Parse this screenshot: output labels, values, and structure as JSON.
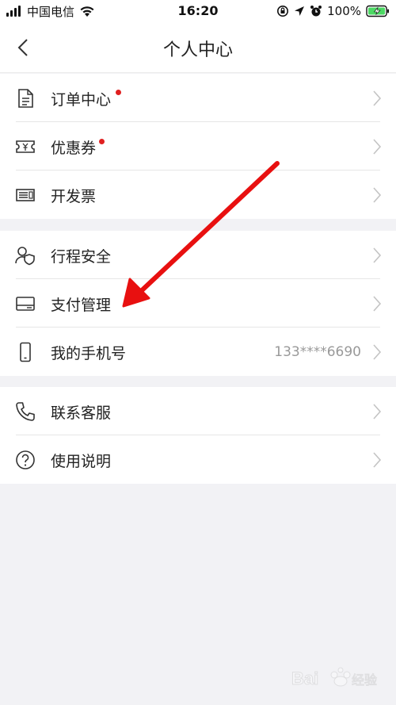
{
  "status_bar": {
    "carrier": "中国电信",
    "time": "16:20",
    "battery": "100%"
  },
  "header": {
    "title": "个人中心"
  },
  "groups": [
    {
      "items": [
        {
          "label": "订单中心",
          "icon": "document-icon",
          "badge": true
        },
        {
          "label": "优惠券",
          "icon": "coupon-icon",
          "badge": true
        },
        {
          "label": "开发票",
          "icon": "invoice-icon",
          "badge": false
        }
      ]
    },
    {
      "items": [
        {
          "label": "行程安全",
          "icon": "users-shield-icon"
        },
        {
          "label": "支付管理",
          "icon": "card-icon"
        },
        {
          "label": "我的手机号",
          "icon": "phone-icon",
          "value": "133****6690"
        }
      ]
    },
    {
      "items": [
        {
          "label": "联系客服",
          "icon": "phone-handset-icon"
        },
        {
          "label": "使用说明",
          "icon": "help-icon"
        }
      ]
    }
  ],
  "colors": {
    "badge": "#e02020",
    "annotation_arrow": "#e81010",
    "background": "#f2f2f5"
  }
}
